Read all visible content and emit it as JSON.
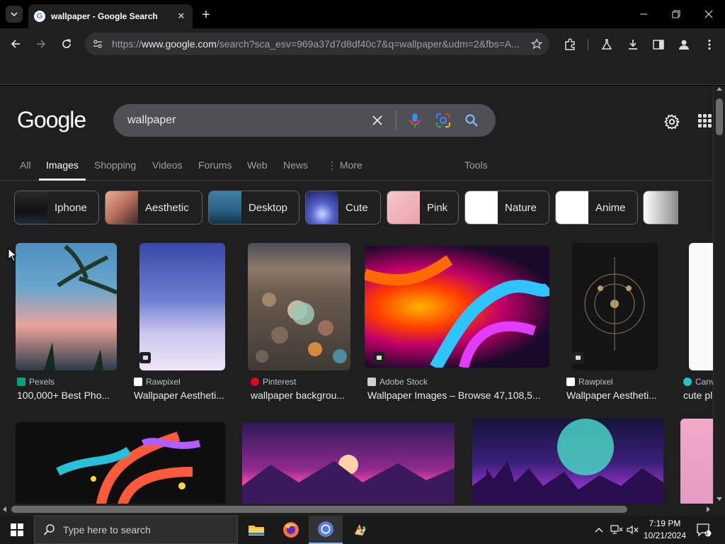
{
  "browser": {
    "tab_title": "wallpaper - Google Search",
    "url_prefix": "https://",
    "url_host": "www.google.com",
    "url_path": "/search?sca_esv=969a37d7d8df40c7&q=wallpaper&udm=2&fbs=A..."
  },
  "google": {
    "logo": "Google",
    "query": "wallpaper",
    "tabs": [
      "All",
      "Images",
      "Shopping",
      "Videos",
      "Forums",
      "Web",
      "News",
      "More"
    ],
    "active_tab": "Images",
    "tools": "Tools",
    "chips": [
      "Iphone",
      "Aesthetic",
      "Desktop",
      "Cute",
      "Pink",
      "Nature",
      "Anime"
    ]
  },
  "results_row1": [
    {
      "source": "Pexels",
      "caption": "100,000+ Best Pho..."
    },
    {
      "source": "Rawpixel",
      "caption": "Wallpaper Aestheti..."
    },
    {
      "source": "Pinterest",
      "caption": "wallpaper backgrou..."
    },
    {
      "source": "Adobe Stock",
      "caption": "Wallpaper Images – Browse 47,108,5..."
    },
    {
      "source": "Rawpixel",
      "caption": "Wallpaper Aestheti..."
    },
    {
      "source": "Canv",
      "caption": "cute pl"
    }
  ],
  "taskbar": {
    "search_placeholder": "Type here to search",
    "time": "7:19 PM",
    "date": "10/21/2024",
    "notification_count": "1"
  },
  "colors": {
    "page_bg": "#1f1f1f",
    "search_box": "#4d5156",
    "chrome_bg": "#000000"
  }
}
